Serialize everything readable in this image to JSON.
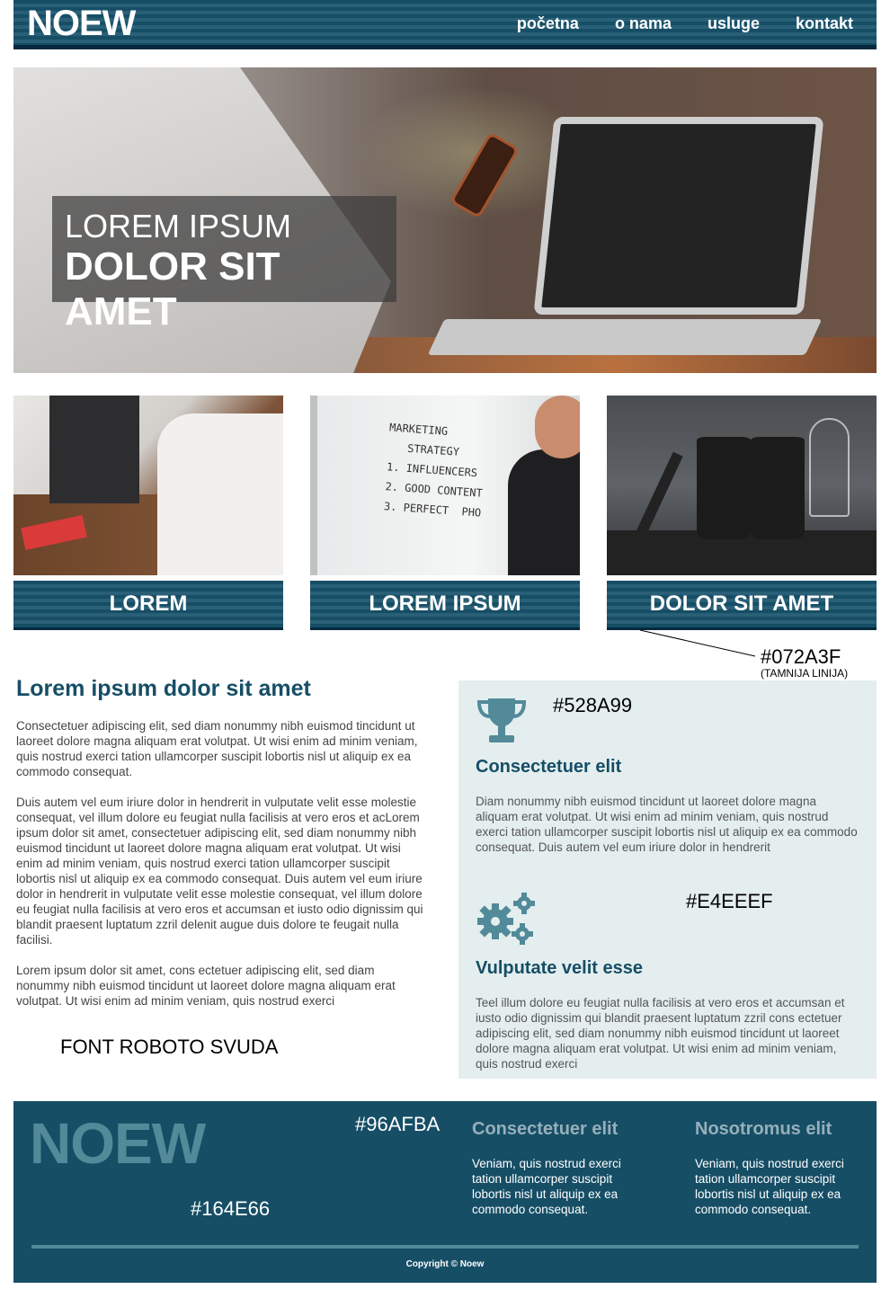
{
  "header": {
    "logo": "NOEW",
    "nav": [
      "početna",
      "o nama",
      "usluge",
      "kontakt"
    ]
  },
  "hero": {
    "line1": "LOREM IPSUM",
    "line2": "DOLOR SIT AMET"
  },
  "cards": [
    {
      "label": "LOREM"
    },
    {
      "label": "LOREM IPSUM"
    },
    {
      "label": "DOLOR SIT AMET"
    }
  ],
  "whiteboard_text": "MARKETING\n   STRATEGY\n1. INFLUENCERS\n2. GOOD CONTENT\n3. PERFECT  PHO",
  "annotations": {
    "dark_line_color": "#072A3F",
    "dark_line_note": "(TAMNIJA LINIJA)",
    "icon_color": "#528A99",
    "side_bg_color": "#E4EEEF",
    "font_note": "FONT ROBOTO SVUDA",
    "footer_title_color": "#96AFBA",
    "footer_bg_color": "#164E66"
  },
  "main": {
    "title": "Lorem ipsum dolor sit amet",
    "paragraphs": [
      "Consectetuer adipiscing elit, sed diam nonummy nibh euismod tincidunt ut laoreet dolore magna aliquam erat volutpat. Ut wisi enim ad minim veniam, quis nostrud exerci tation ullamcorper suscipit lobortis nisl ut aliquip ex ea commodo consequat.",
      "Duis autem vel eum iriure dolor in hendrerit in vulputate velit esse molestie consequat, vel illum dolore eu feugiat nulla facilisis at vero eros et acLorem ipsum dolor sit amet, consectetuer adipiscing elit, sed diam nonummy nibh euismod tincidunt ut laoreet dolore magna aliquam erat volutpat. Ut wisi enim ad minim veniam, quis nostrud exerci tation ullamcorper suscipit lobortis nisl ut aliquip ex ea commodo consequat. Duis autem vel eum iriure dolor in hendrerit in vulputate velit esse molestie consequat, vel illum dolore eu feugiat nulla facilisis at vero eros et accumsan et iusto odio dignissim qui blandit praesent luptatum zzril delenit augue duis dolore te feugait nulla facilisi.",
      "Lorem ipsum dolor sit amet, cons ectetuer adipiscing elit, sed diam nonummy nibh euismod tincidunt ut laoreet dolore magna aliquam erat volutpat. Ut wisi enim ad minim veniam, quis nostrud exerci"
    ]
  },
  "side": {
    "blocks": [
      {
        "icon": "trophy-icon",
        "title": "Consectetuer elit",
        "text": "Diam nonummy nibh euismod tincidunt ut laoreet dolore magna aliquam erat volutpat. Ut wisi enim ad minim veniam, quis nostrud exerci tation ullamcorper suscipit lobortis nisl ut aliquip ex ea commodo consequat. Duis autem vel eum iriure dolor in hendrerit"
      },
      {
        "icon": "gears-icon",
        "title": "Vulputate velit esse",
        "text": "Teel illum dolore eu feugiat nulla facilisis at vero eros et accumsan et iusto odio dignissim qui blandit praesent luptatum zzril cons ectetuer adipiscing elit, sed diam nonummy nibh euismod tincidunt ut laoreet dolore magna aliquam erat volutpat. Ut wisi enim ad minim veniam, quis nostrud exerci"
      }
    ]
  },
  "footer": {
    "logo": "NOEW",
    "columns": [
      {
        "title": "Consectetuer elit",
        "text": "Veniam, quis nostrud exerci tation ullamcorper suscipit lobortis nisl ut aliquip ex ea commodo consequat."
      },
      {
        "title": "Nosotromus elit",
        "text": "Veniam, quis nostrud exerci tation ullamcorper suscipit lobortis nisl ut aliquip ex ea commodo consequat."
      }
    ],
    "copyright": "Copyright © Noew"
  }
}
